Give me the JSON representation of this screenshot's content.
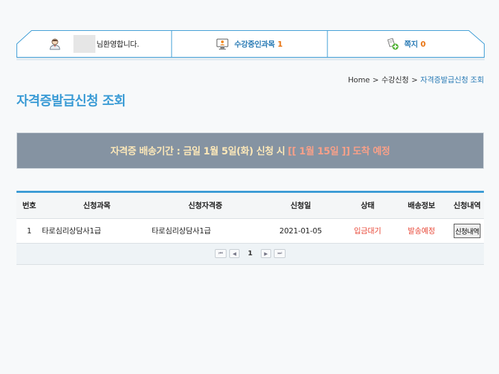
{
  "topbar": {
    "welcome_text": "님환영합니다.",
    "courses_label": "수강중인과목",
    "courses_count": "1",
    "notes_label": "쪽지",
    "notes_count": "0"
  },
  "breadcrumb": {
    "home": "Home",
    "level1": "수강신청",
    "current": "자격증발급신청 조회",
    "sep": ">"
  },
  "page_title": "자격증발급신청 조회",
  "notice": {
    "prefix": "자격증 배송기간 : 금일 1월 5일(화) 신청 시",
    "highlight": "[[ 1월 15일 ]]",
    "suffix": "도착 예정"
  },
  "table": {
    "headers": [
      "번호",
      "신청과목",
      "신청자격증",
      "신청일",
      "상태",
      "배송정보",
      "신청내역"
    ],
    "rows": [
      {
        "no": "1",
        "course": "타로심리상담사1급",
        "cert": "타로심리상담사1급",
        "date": "2021-01-05",
        "status": "입금대기",
        "shipping": "발송예정",
        "detail_label": "신청내역"
      }
    ]
  },
  "pagination": {
    "current_page": "1",
    "first": "⏮",
    "prev": "◀",
    "next": "▶",
    "last": "⏭"
  },
  "colors": {
    "accent": "#3a9bd5",
    "notice_bg": "#8593a2",
    "status_red": "#e84a3a",
    "count_orange": "#e8720f"
  }
}
